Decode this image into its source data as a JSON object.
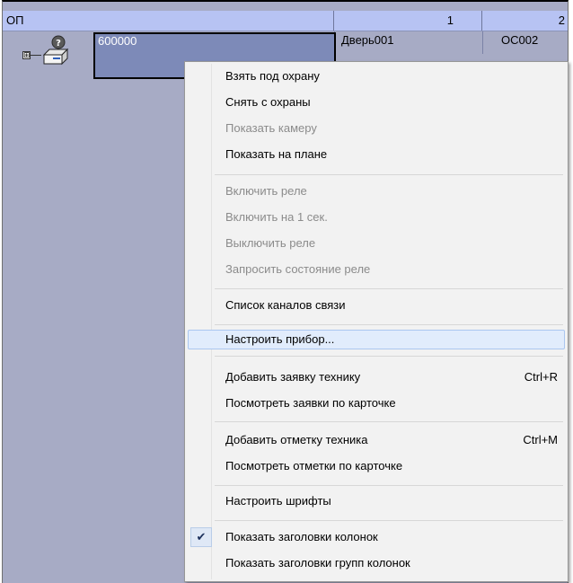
{
  "columns": {
    "main": "ОП",
    "col1": "1",
    "col2": "2"
  },
  "tree_row": {
    "node": "600000",
    "col1": "Дверь001",
    "col2": "ОС002",
    "expander": "⊞"
  },
  "icons": {
    "device": "device-question-icon",
    "check": "check-icon"
  },
  "menu": {
    "items": [
      {
        "label": "Взять под охрану",
        "enabled": true,
        "shortcut": ""
      },
      {
        "label": "Снять с охраны",
        "enabled": true,
        "shortcut": ""
      },
      {
        "label": "Показать камеру",
        "enabled": false,
        "shortcut": ""
      },
      {
        "label": "Показать на плане",
        "enabled": true,
        "shortcut": ""
      },
      {
        "label": "Включить реле",
        "enabled": false,
        "shortcut": ""
      },
      {
        "label": "Включить на 1 сек.",
        "enabled": false,
        "shortcut": ""
      },
      {
        "label": "Выключить реле",
        "enabled": false,
        "shortcut": ""
      },
      {
        "label": "Запросить состояние реле",
        "enabled": false,
        "shortcut": ""
      },
      {
        "label": "Список каналов связи",
        "enabled": true,
        "shortcut": ""
      },
      {
        "label": "Настроить прибор...",
        "enabled": true,
        "shortcut": "",
        "highlighted": true
      },
      {
        "label": "Добавить заявку технику",
        "enabled": true,
        "shortcut": "Ctrl+R"
      },
      {
        "label": "Посмотреть заявки по карточке",
        "enabled": true,
        "shortcut": ""
      },
      {
        "label": "Добавить отметку техника",
        "enabled": true,
        "shortcut": "Ctrl+M"
      },
      {
        "label": "Посмотреть отметки по карточке",
        "enabled": true,
        "shortcut": ""
      },
      {
        "label": "Настроить шрифты",
        "enabled": true,
        "shortcut": ""
      },
      {
        "label": "Показать заголовки колонок",
        "enabled": true,
        "shortcut": "",
        "checked": true
      },
      {
        "label": "Показать заголовки групп колонок",
        "enabled": true,
        "shortcut": ""
      }
    ]
  },
  "colors": {
    "background": "#a7abc5",
    "header": "#b7c3f3",
    "menu": "#f2f2f2",
    "highlight": "#e1ecfc",
    "disabled_text": "#8b8b8b"
  }
}
